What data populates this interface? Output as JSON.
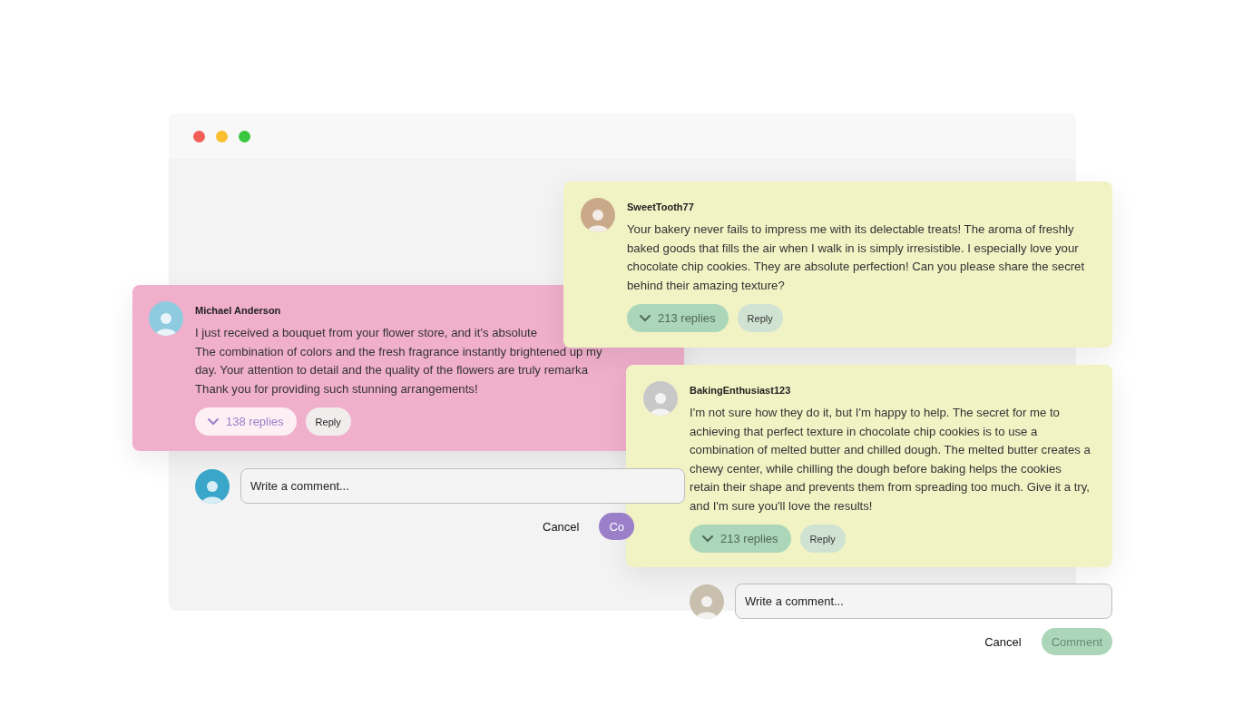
{
  "comments": [
    {
      "author": "Michael Anderson",
      "color": "#f0afcb",
      "kind": "pink",
      "lines": [
        "I just received a bouquet from your flower store, and it's absolute",
        "The combination of colors and the fresh fragrance instantly brightened up my",
        "day. Your attention to detail and the quality of the flowers are truly remarka",
        "Thank you for providing such stunning arrangements!"
      ],
      "replies": "138 replies",
      "reply": "Reply"
    },
    {
      "author": "SweetTooth77",
      "color": "#f1f3c5",
      "kind": "yellow",
      "text": "Your bakery never fails to impress me with its delectable treats! The aroma of freshly baked goods that fills the air when I walk in is simply irresistible. I especially love your chocolate chip cookies. They are absolute perfection! Can you please share the secret behind their amazing texture?",
      "replies": "213 replies",
      "reply": "Reply"
    },
    {
      "author": "BakingEnthusiast123",
      "color": "#f1f3c5",
      "kind": "yellow",
      "text": "I'm not sure how they do it, but I'm happy to help. The secret for me to achieving that perfect texture in chocolate chip cookies is to use a combination of melted butter and chilled dough. The melted butter creates a chewy center, while chilling the dough before baking helps the cookies retain their shape and prevents them from spreading too much. Give it a try, and I'm sure you'll love the results!",
      "replies": "213 replies",
      "reply": "Reply"
    }
  ],
  "composers": [
    {
      "kind": "purple",
      "placeholder": "Write a comment...",
      "cancel": "Cancel",
      "submit": "Co"
    },
    {
      "kind": "green",
      "placeholder": "Write a comment...",
      "cancel": "Cancel",
      "submit": "Comment"
    }
  ]
}
